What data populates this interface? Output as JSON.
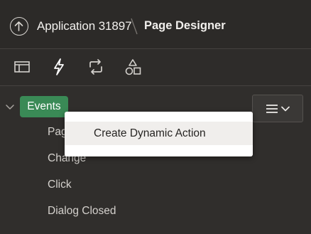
{
  "header": {
    "app_name": "Application 31897",
    "page_title": "Page Designer",
    "app_icon": "arrow-up-circle-icon"
  },
  "tabs": [
    {
      "name": "rendering",
      "icon": "layout-icon",
      "selected": false
    },
    {
      "name": "dynamic-actions",
      "icon": "lightning-icon",
      "selected": true
    },
    {
      "name": "processing",
      "icon": "refresh-arrows-icon",
      "selected": false
    },
    {
      "name": "shared-components",
      "icon": "shapes-icon",
      "selected": false
    }
  ],
  "tree": {
    "root_label": "Events",
    "items": [
      "Page Load",
      "Change",
      "Click",
      "Dialog Closed"
    ],
    "visible_items": [
      "Pag",
      "Change",
      "Click",
      "Dialog Closed"
    ]
  },
  "menu_button": {
    "icon": "hamburger-icon",
    "chevron": "chevron-down-icon"
  },
  "context_menu": {
    "items": [
      "Create Dynamic Action"
    ]
  },
  "colors": {
    "background": "#302e2c",
    "events_badge": "#3a8a56",
    "popup_bg": "#ffffff"
  }
}
